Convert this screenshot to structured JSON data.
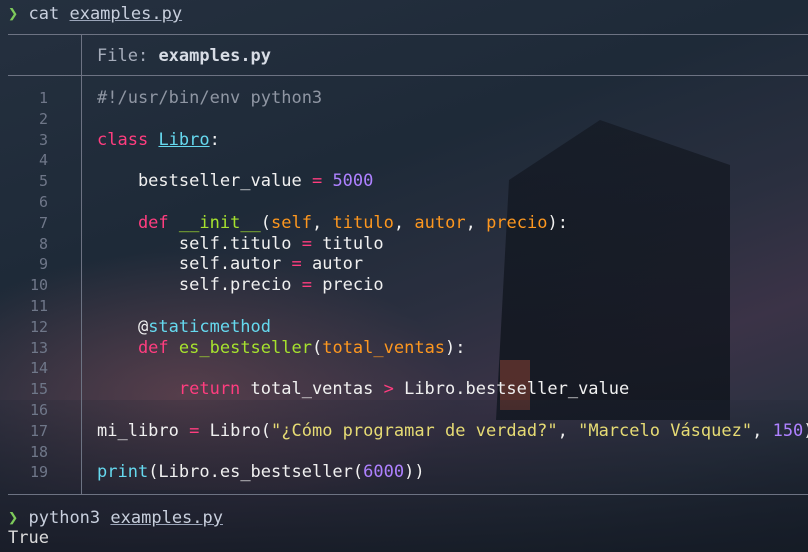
{
  "terminal": {
    "prompt_symbol": "❯",
    "first_command": "cat",
    "first_arg": "examples.py",
    "file_label": "File:",
    "file_name": "examples.py",
    "run_command": "python3",
    "run_arg": "examples.py",
    "output": "True"
  },
  "line_numbers": [
    "1",
    "2",
    "3",
    "4",
    "5",
    "6",
    "7",
    "8",
    "9",
    "10",
    "11",
    "12",
    "13",
    "14",
    "15",
    "16",
    "17",
    "18",
    "19"
  ],
  "code": {
    "l1": "#!/usr/bin/env python3",
    "l3_kw": "class",
    "l3_name": "Libro",
    "l3_colon": ":",
    "l5_name": "    bestseller_value ",
    "l5_op": "=",
    "l5_val": "5000",
    "l7_kw": "    def",
    "l7_fn": "__init__",
    "l7_open": "(",
    "l7_p1": "self",
    "l7_sep1": ", ",
    "l7_p2": "titulo",
    "l7_sep2": ", ",
    "l7_p3": "autor",
    "l7_sep3": ", ",
    "l7_p4": "precio",
    "l7_close": "):",
    "l8_a": "        self.titulo ",
    "l8_op": "=",
    "l8_b": " titulo",
    "l9_a": "        self.autor ",
    "l9_op": "=",
    "l9_b": " autor",
    "l10_a": "        self.precio ",
    "l10_op": "=",
    "l10_b": " precio",
    "l12_at": "    @",
    "l12_deco": "staticmethod",
    "l13_kw": "    def",
    "l13_fn": "es_bestseller",
    "l13_open": "(",
    "l13_p": "total_ventas",
    "l13_close": "):",
    "l15_kw": "        return",
    "l15_a": " total_ventas ",
    "l15_op": ">",
    "l15_b": " Libro.bestseller_value",
    "l17_a": "mi_libro ",
    "l17_op": "=",
    "l17_b": " Libro(",
    "l17_s1": "\"¿Cómo programar de verdad?\"",
    "l17_c1": ", ",
    "l17_s2": "\"Marcelo Vásquez\"",
    "l17_c2": ", ",
    "l17_n": "150",
    "l17_end": ")",
    "l19_fn": "print",
    "l19_a": "(Libro.",
    "l19_b": "es_bestseller",
    "l19_c": "(",
    "l19_n": "6000",
    "l19_d": "))"
  }
}
